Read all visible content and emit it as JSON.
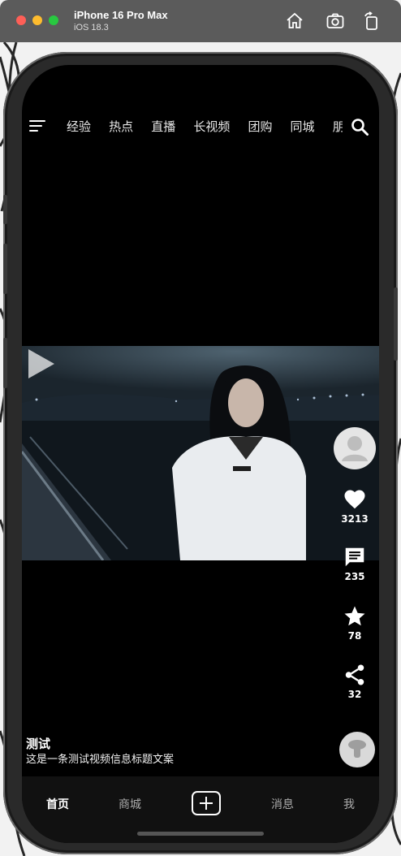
{
  "window": {
    "title": "iPhone 16 Pro Max",
    "subtitle": "iOS 18.3",
    "toolbar_icons": [
      "home-icon",
      "screenshot-icon",
      "rotate-icon"
    ]
  },
  "topnav": {
    "tabs": [
      "经验",
      "热点",
      "直播",
      "长视频",
      "团购",
      "同城",
      "朋友"
    ],
    "icons": [
      "menu-icon",
      "search-icon"
    ]
  },
  "actions": {
    "likes": "3213",
    "comments": "235",
    "favorites": "78",
    "shares": "32"
  },
  "info": {
    "author": "测试",
    "description": "这是一条测试视频信息标题文案"
  },
  "tabbar": {
    "home": "首页",
    "mall": "商城",
    "messages": "消息",
    "me": "我"
  },
  "colors": {
    "screen_bg": "#000000",
    "tabbar_bg": "#111111",
    "window_chrome": "#5b5b5b"
  }
}
